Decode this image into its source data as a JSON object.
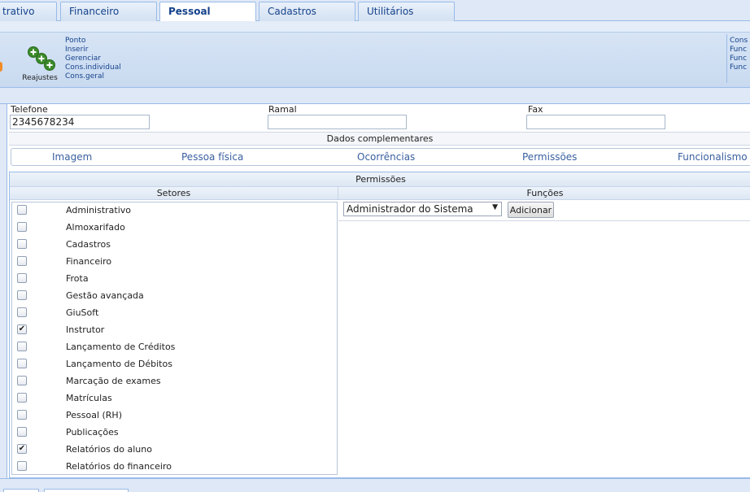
{
  "tabs": [
    {
      "label": "trativo",
      "active": false
    },
    {
      "label": "Financeiro",
      "active": false
    },
    {
      "label": "Pessoal",
      "active": true
    },
    {
      "label": "Cadastros",
      "active": false
    },
    {
      "label": "Utilitários",
      "active": false
    }
  ],
  "ribbon": {
    "reajustes_label": "Reajustes",
    "links": [
      "Ponto",
      "Inserir",
      "Gerenciar",
      "Cons.individual",
      "Cons.geral"
    ],
    "right_links": [
      "Cons",
      "Func",
      "Func",
      "Func"
    ]
  },
  "contact": {
    "telefone_label": "Telefone",
    "telefone_value": "2345678234",
    "ramal_label": "Ramal",
    "ramal_value": "",
    "fax_label": "Fax",
    "fax_value": ""
  },
  "dados_complementares": "Dados complementares",
  "subtabs": [
    "Imagem",
    "Pessoa física",
    "Ocorrências",
    "Permissões",
    "Funcionalismo"
  ],
  "permissoes": {
    "title": "Permissões",
    "setores_header": "Setores",
    "funcoes_header": "Funções",
    "setores": [
      {
        "label": "Administrativo",
        "checked": false
      },
      {
        "label": "Almoxarifado",
        "checked": false
      },
      {
        "label": "Cadastros",
        "checked": false
      },
      {
        "label": "Financeiro",
        "checked": false
      },
      {
        "label": "Frota",
        "checked": false
      },
      {
        "label": "Gestão avançada",
        "checked": false
      },
      {
        "label": "GiuSoft",
        "checked": false
      },
      {
        "label": "Instrutor",
        "checked": true
      },
      {
        "label": "Lançamento de Créditos",
        "checked": false
      },
      {
        "label": "Lançamento de Débitos",
        "checked": false
      },
      {
        "label": "Marcação de exames",
        "checked": false
      },
      {
        "label": "Matrículas",
        "checked": false
      },
      {
        "label": "Pessoal (RH)",
        "checked": false
      },
      {
        "label": "Publicações",
        "checked": false
      },
      {
        "label": "Relatórios do aluno",
        "checked": true
      },
      {
        "label": "Relatórios do financeiro",
        "checked": false
      }
    ],
    "funcao_select_value": "Administrador do Sistema",
    "adicionar_label": "Adicionar"
  },
  "colors": {
    "tab_text": "#15428b",
    "border": "#99bbe8",
    "ribbon_bg": "#c9daf0",
    "accent_orange": "#f28c28",
    "icon_green": "#3c8b2c"
  },
  "icons": {
    "reajustes": "green-plus-cluster-icon",
    "select_arrow": "dropdown-arrow-icon",
    "checkbox_mark": "check-icon"
  }
}
